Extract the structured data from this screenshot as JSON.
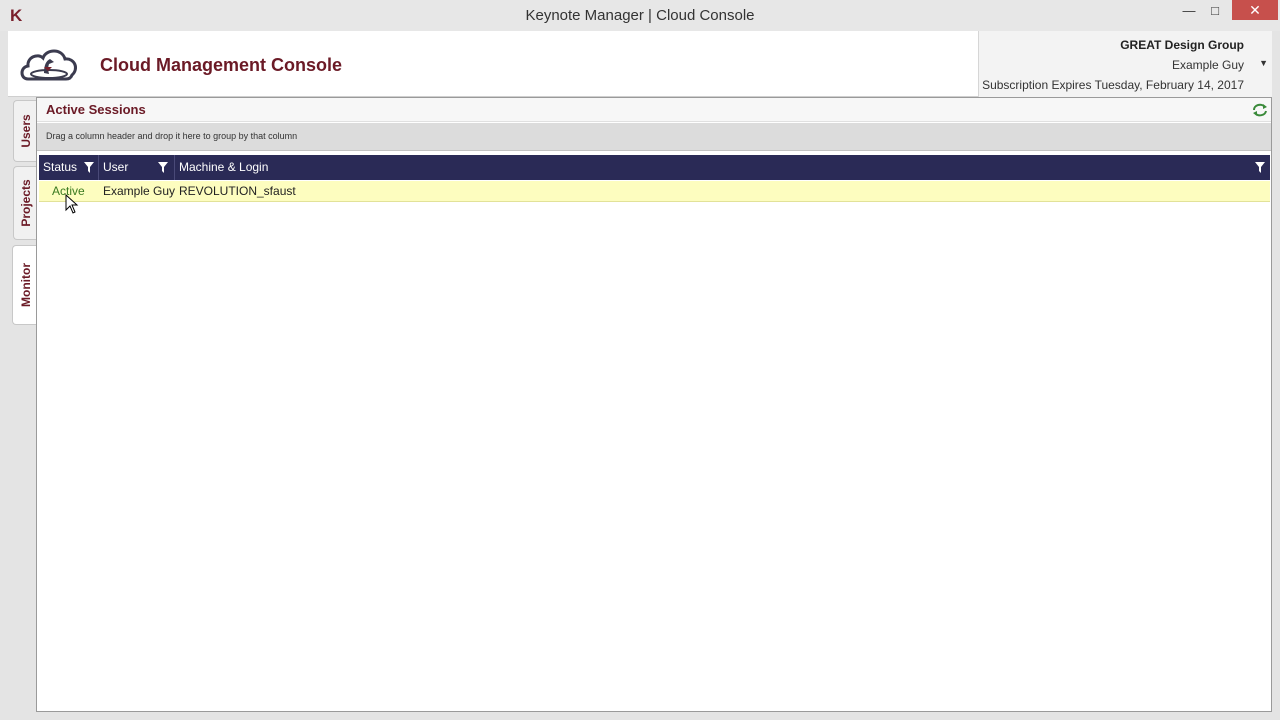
{
  "window": {
    "app_icon": "K",
    "title": "Keynote Manager | Cloud Console",
    "minimize_label": "—",
    "maximize_label": "□",
    "close_label": "✕"
  },
  "header": {
    "console_title": "Cloud Management Console",
    "account": {
      "organization": "GREAT Design Group",
      "user": "Example Guy",
      "subscription": "Subscription Expires Tuesday, February 14, 2017"
    }
  },
  "tabs": [
    {
      "label": "Users",
      "active": false
    },
    {
      "label": "Projects",
      "active": false
    },
    {
      "label": "Monitor",
      "active": true
    }
  ],
  "section": {
    "title": "Active Sessions",
    "group_hint": "Drag a column header and drop it here to group by that column"
  },
  "grid": {
    "columns": [
      "Status",
      "User",
      "Machine & Login"
    ],
    "rows": [
      {
        "status": "Active",
        "user": "Example Guy",
        "machine_login": "REVOLUTION_sfaust"
      }
    ]
  },
  "colors": {
    "brand": "#6b1a26",
    "grid_header": "#2a2a56",
    "selected_row": "#fdfdbf",
    "status_active": "#3a7a20",
    "close_button": "#c7504c"
  },
  "icons": [
    "cloud-logo-icon",
    "refresh-icon",
    "filter-icon",
    "dropdown-arrow-icon",
    "mouse-cursor-icon"
  ]
}
